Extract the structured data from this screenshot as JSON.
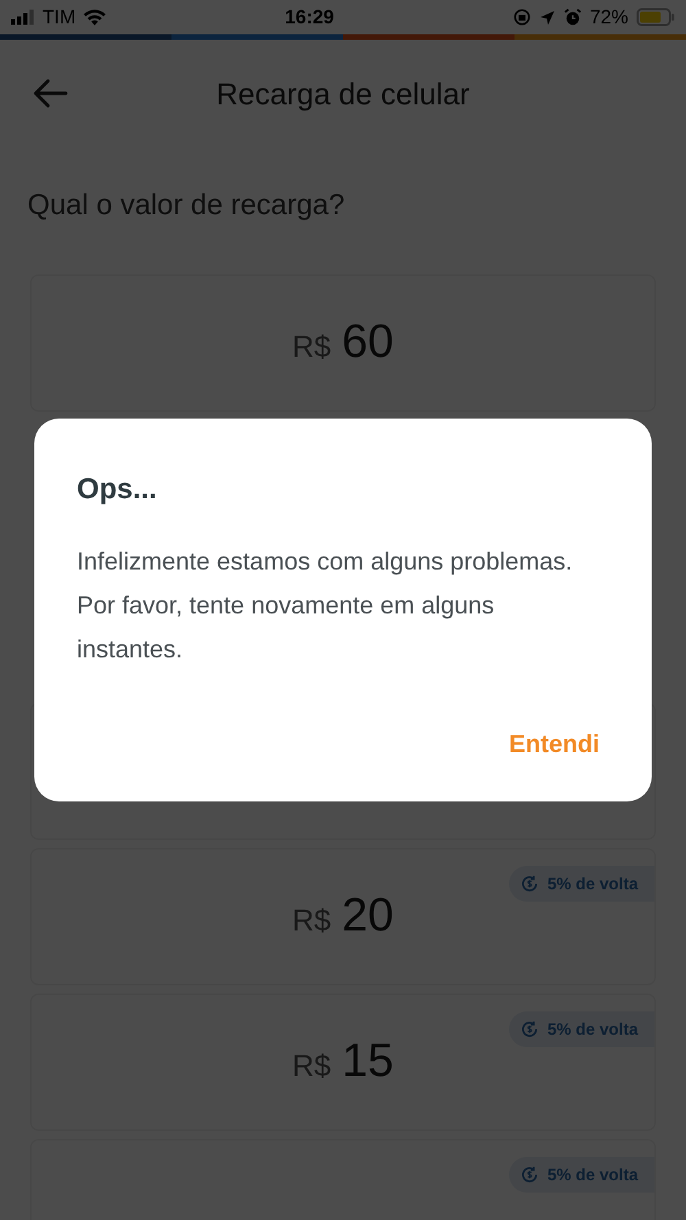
{
  "status_bar": {
    "carrier": "TIM",
    "time": "16:29",
    "battery": "72%"
  },
  "header": {
    "title": "Recarga de celular"
  },
  "question": "Qual o valor de recarga?",
  "cards": [
    {
      "currency": "R$",
      "amount": "60"
    },
    {
      "currency": "R$",
      "amount": "20",
      "badge": "5% de volta"
    },
    {
      "currency": "R$",
      "amount": "15",
      "badge": "5% de volta"
    },
    {
      "badge": "5% de volta"
    }
  ],
  "dialog": {
    "title": "Ops...",
    "message": "Infelizmente estamos com alguns problemas. Por favor, tente novamente em alguns instantes.",
    "button": "Entendi"
  }
}
